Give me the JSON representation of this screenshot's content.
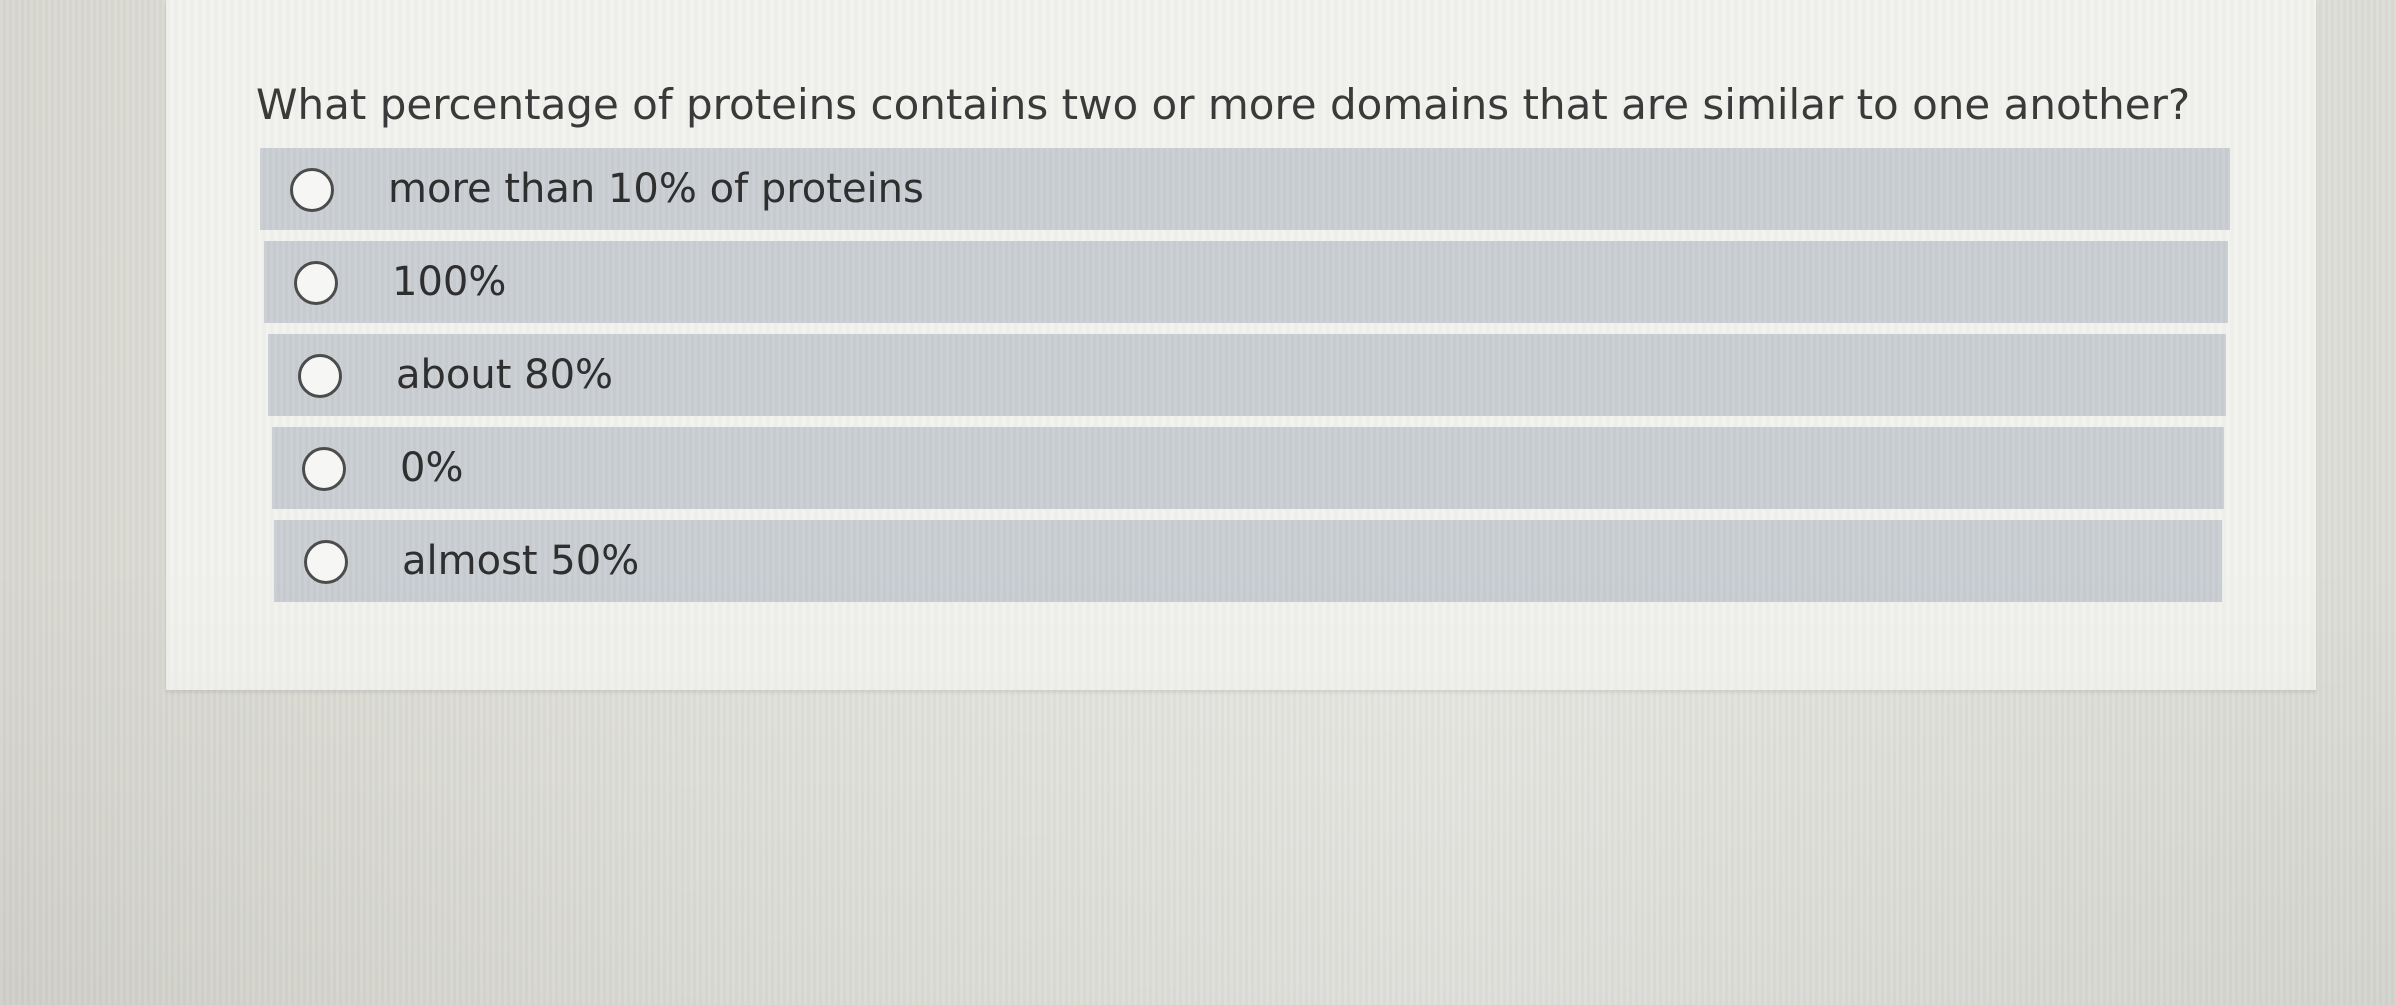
{
  "question": "What percentage of proteins contains two or more domains that are similar to one another?",
  "options": [
    {
      "label": "more than 10% of proteins",
      "selected": false
    },
    {
      "label": "100%",
      "selected": false
    },
    {
      "label": "about 80%",
      "selected": false
    },
    {
      "label": "0%",
      "selected": false
    },
    {
      "label": "almost 50%",
      "selected": false
    }
  ],
  "colors": {
    "option_background": "#c9ced3",
    "card_background": "#f1f1ed",
    "text": "#3a3a3a"
  }
}
